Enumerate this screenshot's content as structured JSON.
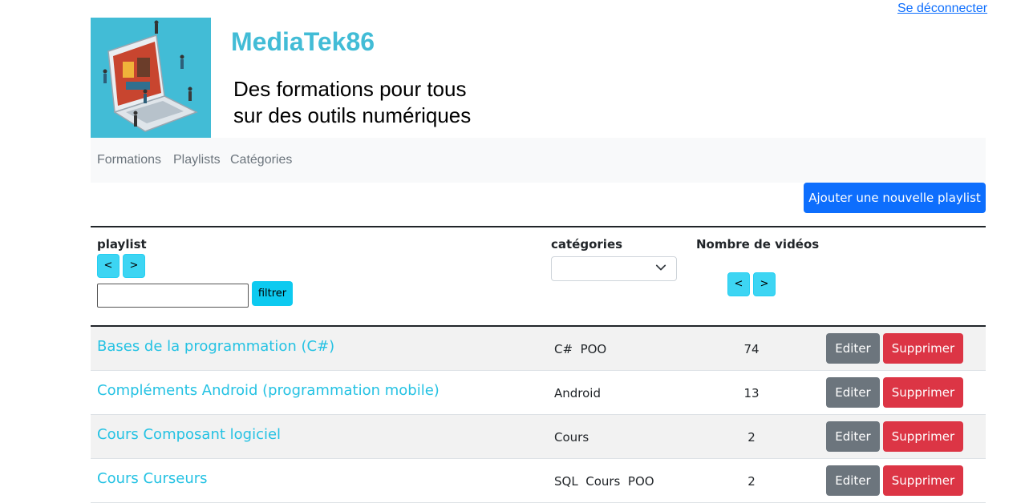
{
  "auth": {
    "logout_label": "Se déconnecter"
  },
  "header": {
    "title": "MediaTek86",
    "tagline_line1": "Des formations pour tous",
    "tagline_line2": "sur des outils numériques"
  },
  "nav": {
    "items": [
      "Formations",
      "Playlists",
      "Catégories"
    ]
  },
  "actions": {
    "add_playlist": "Ajouter une nouvelle playlist"
  },
  "table": {
    "headers": {
      "playlist": "playlist",
      "categories": "catégories",
      "count": "Nombre de vidéos"
    },
    "sort_prev": "<",
    "sort_next": ">",
    "filter_button": "filtrer",
    "filter_value": "",
    "category_selected": "",
    "edit_label": "Editer",
    "delete_label": "Supprimer",
    "rows": [
      {
        "name": "Bases de la programmation (C#)",
        "categories": "C#  POO",
        "count": "74"
      },
      {
        "name": "Compléments Android (programmation mobile)",
        "categories": "Android",
        "count": "13"
      },
      {
        "name": "Cours Composant logiciel",
        "categories": "Cours",
        "count": "2"
      },
      {
        "name": "Cours Curseurs",
        "categories": "SQL  Cours  POO",
        "count": "2"
      }
    ]
  },
  "colors": {
    "brand": "#42bcd6",
    "link": "#25c2e3",
    "primary": "#0d6efd",
    "info": "#0dcaf0",
    "secondary": "#6c757d",
    "danger": "#dc3545"
  }
}
